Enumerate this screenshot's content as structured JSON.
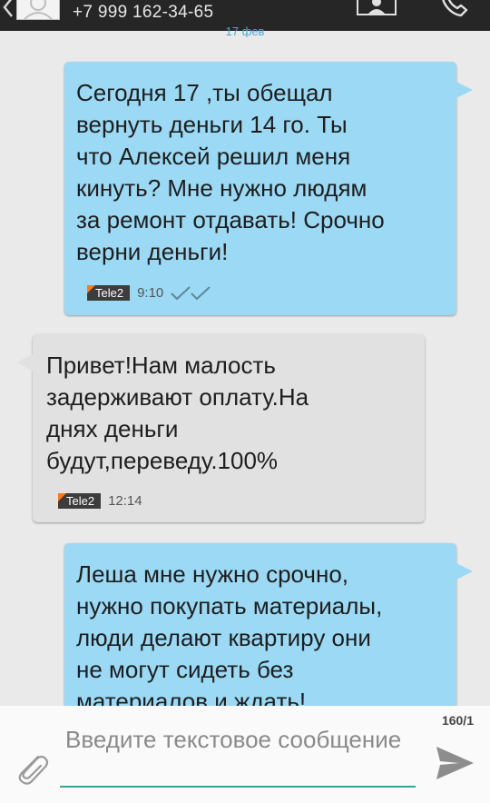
{
  "header": {
    "phone": "+7 999 162-34-65",
    "icons": [
      "back-chevron-icon",
      "contact-avatar-icon",
      "contact-card-icon",
      "call-icon"
    ]
  },
  "date_label": "17 фев",
  "messages": [
    {
      "direction": "outgoing",
      "text": "Сегодня 17 ,ты обещал\nвернуть деньги 14 го. Ты\nчто Алексей решил меня\nкинуть? Мне нужно людям\nза ремонт отдавать! Срочно\nверни деньги!",
      "operator": "Tele2",
      "time": "9:10",
      "status": "delivered-double-check"
    },
    {
      "direction": "incoming",
      "text": "Привет!Нам малость\nзадерживают оплату.На\nднях деньги\nбудут,переведу.100%",
      "operator": "Tele2",
      "time": "12:14"
    },
    {
      "direction": "outgoing",
      "text": "Леша мне нужно срочно,\nнужно покупать материалы,\nлюди делают квартиру они\nне могут сидеть без\nматериалов и ждать!"
    }
  ],
  "compose": {
    "counter": "160/1",
    "placeholder": "Введите текстовое сообщение"
  },
  "colors": {
    "outgoing_bubble": "#9bd9f5",
    "incoming_bubble": "#e1e1e1",
    "accent": "#2fa89a",
    "operator_flag": "#ff7a1a"
  }
}
